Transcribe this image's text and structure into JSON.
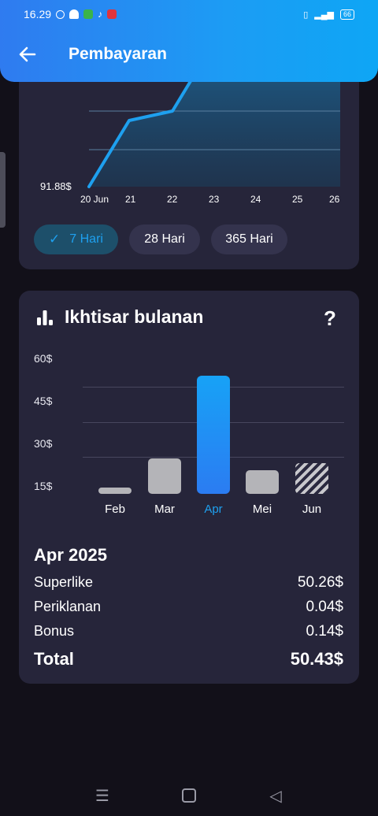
{
  "status_bar": {
    "time": "16.29",
    "battery": "66"
  },
  "app_bar": {
    "title": "Pembayaran"
  },
  "line_chart": {
    "y_min_label": "91.88$",
    "x_labels": [
      "20 Jun",
      "21",
      "22",
      "23",
      "24",
      "25",
      "26"
    ],
    "line_color": "#1ea0ef"
  },
  "range_chips": [
    {
      "label": "7 Hari",
      "active": true
    },
    {
      "label": "28 Hari",
      "active": false
    },
    {
      "label": "365 Hari",
      "active": false
    }
  ],
  "monthly": {
    "title": "Ikhtisar bulanan",
    "help": "?",
    "y_labels": [
      "60$",
      "45$",
      "30$",
      "15$"
    ]
  },
  "chart_data": {
    "type": "bar",
    "categories": [
      "Feb",
      "Mar",
      "Apr",
      "Mei",
      "Jun"
    ],
    "values": [
      2,
      15,
      50.43,
      10,
      13
    ],
    "highlighted": "Apr",
    "hatched": "Jun",
    "ylim": [
      0,
      60
    ],
    "y_ticks": [
      "15$",
      "30$",
      "45$",
      "60$"
    ],
    "colors": {
      "highlight": "#1ea0ef",
      "default": "#b4b4b8"
    }
  },
  "summary": {
    "period": "Apr 2025",
    "rows": [
      {
        "label": "Superlike",
        "value": "50.26$"
      },
      {
        "label": "Periklanan",
        "value": "0.04$"
      },
      {
        "label": "Bonus",
        "value": "0.14$"
      }
    ],
    "total": {
      "label": "Total",
      "value": "50.43$"
    }
  }
}
